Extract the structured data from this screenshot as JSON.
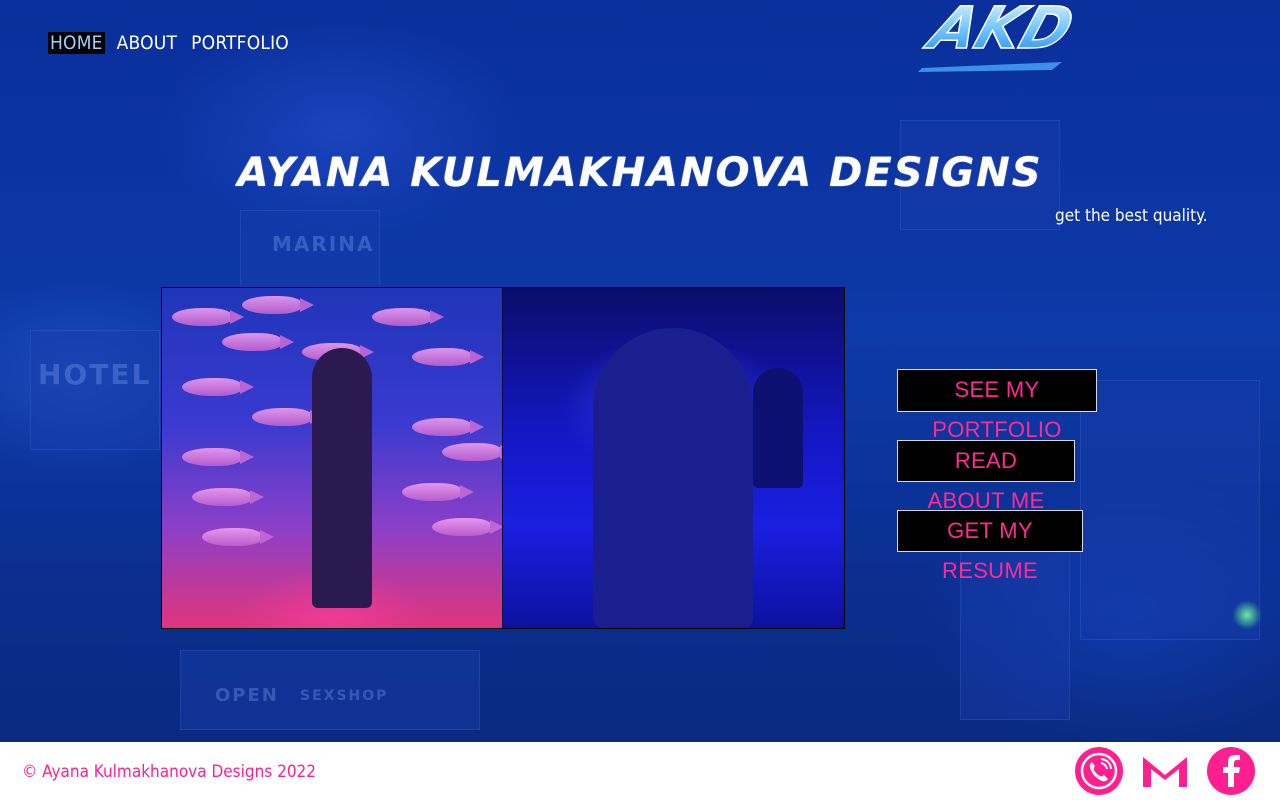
{
  "nav": {
    "items": [
      {
        "label": "HOME",
        "active": true
      },
      {
        "label": "ABOUT",
        "active": false
      },
      {
        "label": "PORTFOLIO",
        "active": false
      }
    ]
  },
  "logo": {
    "text": "AKD"
  },
  "hero": {
    "title": "AYANA KULMAKHANOVA DESIGNS",
    "tagline": "get the best quality."
  },
  "buttons": {
    "portfolio": "SEE MY PORTFOLIO",
    "about": "READ ABOUT ME",
    "resume": "GET MY RESUME"
  },
  "footer": {
    "copyright": "© Ayana Kulmakhanova Designs 2022",
    "icons": [
      "phone-icon",
      "gmail-icon",
      "facebook-icon"
    ]
  },
  "colors": {
    "accent": "#ff1f8f",
    "background": "#0b2a8a",
    "nav_active_bg": "#000000"
  }
}
